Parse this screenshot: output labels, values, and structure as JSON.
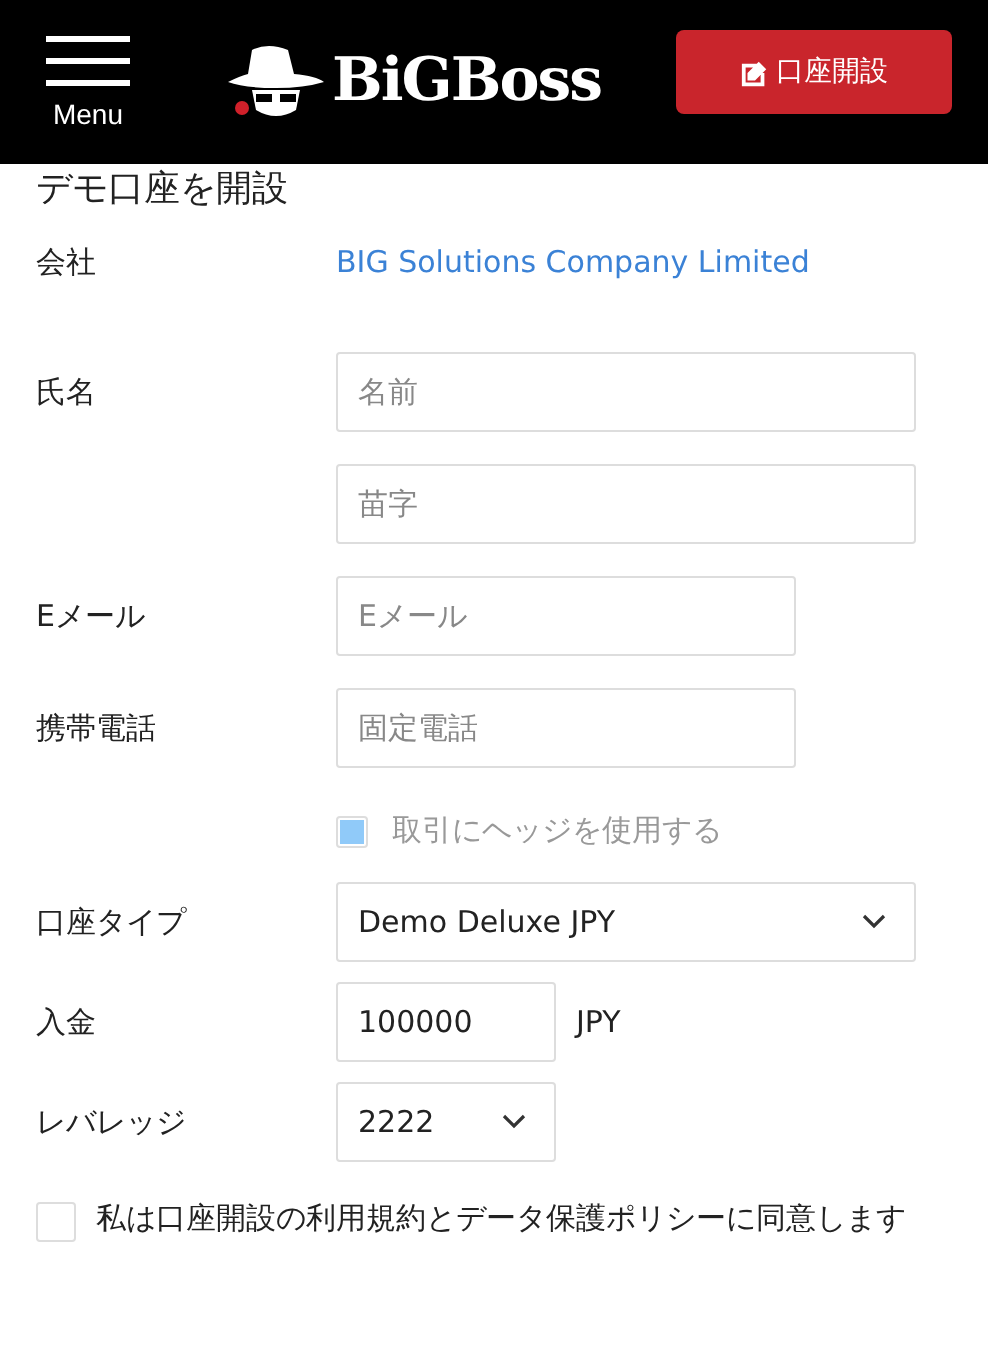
{
  "header": {
    "menu_label": "Menu",
    "logo": "BiGBoss",
    "open_account_button": "口座開設"
  },
  "title": "デモ口座を開設",
  "rows": [
    {
      "kind": "info",
      "label": "会社",
      "value": "BIG Solutions Company Limited"
    },
    {
      "kind": "inputs",
      "label": "氏名",
      "inputs": [
        {
          "placeholder": "名前"
        },
        {
          "placeholder": "苗字"
        }
      ]
    },
    {
      "kind": "inputs",
      "label": "Eメール",
      "inputs": [
        {
          "placeholder": "Eメール"
        }
      ]
    },
    {
      "kind": "inputs",
      "label": "携帯電話",
      "inputs": [
        {
          "placeholder": "固定電話"
        }
      ]
    },
    {
      "kind": "checkbox",
      "label": "取引にヘッジを使用する",
      "checked": true,
      "disabled": true
    },
    {
      "kind": "select",
      "label": "口座タイプ",
      "value": "Demo Deluxe JPY"
    },
    {
      "kind": "amount",
      "label": "入金",
      "value": "100000",
      "unit": "JPY"
    },
    {
      "kind": "select",
      "label": "レバレッジ",
      "value": "2222"
    }
  ],
  "agreement": {
    "text": "私は口座開設の利用規約とデータ保護ポリシーに同意します",
    "checked": false
  }
}
